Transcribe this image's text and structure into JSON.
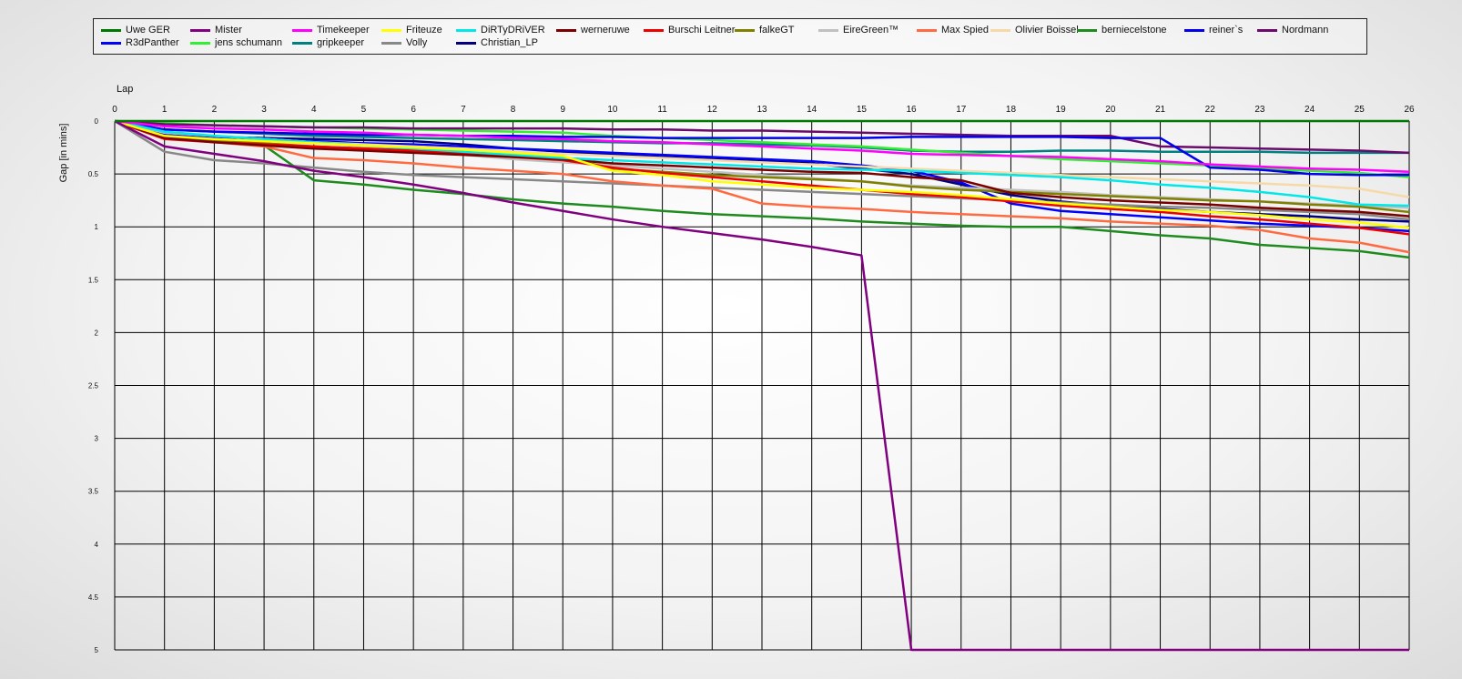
{
  "chart_data": {
    "type": "line",
    "xlabel": "Lap",
    "ylabel": "Gap [in mins]",
    "xlim": [
      0,
      26
    ],
    "ylim": [
      0,
      5
    ],
    "x_ticks": [
      0,
      1,
      2,
      3,
      4,
      5,
      6,
      7,
      8,
      9,
      10,
      11,
      12,
      13,
      14,
      15,
      16,
      17,
      18,
      19,
      20,
      21,
      22,
      23,
      24,
      25,
      26
    ],
    "y_ticks": [
      0,
      0.5,
      1,
      1.5,
      2,
      2.5,
      3,
      3.5,
      4,
      4.5,
      5
    ],
    "y_inverted": true,
    "grid": true,
    "legend_position": "top",
    "series": [
      {
        "name": "Uwe GER",
        "color": "#007700",
        "values": [
          0,
          0,
          0,
          0,
          0,
          0,
          0,
          0,
          0,
          0,
          0,
          0,
          0,
          0,
          0,
          0,
          0,
          0,
          0,
          0,
          0,
          0,
          0,
          0,
          0,
          0,
          0
        ]
      },
      {
        "name": "Mister",
        "color": "#800080",
        "values": [
          0,
          0.24,
          0.31,
          0.38,
          0.47,
          0.53,
          0.6,
          0.68,
          0.77,
          0.85,
          0.93,
          1.0,
          1.06,
          1.12,
          1.19,
          1.27,
          5.0,
          5.0,
          5.0,
          5.0,
          5.0,
          5.0,
          5.0,
          5.0,
          5.0,
          5.0,
          5.0
        ]
      },
      {
        "name": "Timekeeper",
        "color": "#ff00ff",
        "values": [
          0,
          0.05,
          0.07,
          0.08,
          0.1,
          0.11,
          0.13,
          0.14,
          0.16,
          0.17,
          0.19,
          0.2,
          0.22,
          0.24,
          0.26,
          0.28,
          0.31,
          0.32,
          0.33,
          0.34,
          0.36,
          0.38,
          0.41,
          0.43,
          0.45,
          0.46,
          0.48
        ]
      },
      {
        "name": "Friteuze",
        "color": "#ffff00",
        "values": [
          0,
          0.14,
          0.17,
          0.19,
          0.21,
          0.23,
          0.25,
          0.27,
          0.3,
          0.33,
          0.47,
          0.51,
          0.57,
          0.6,
          0.63,
          0.65,
          0.67,
          0.7,
          0.74,
          0.78,
          0.81,
          0.84,
          0.86,
          0.89,
          0.93,
          0.96,
          1.01
        ]
      },
      {
        "name": "DiRTyDRiVER",
        "color": "#00e8e8",
        "values": [
          0,
          0.1,
          0.14,
          0.17,
          0.2,
          0.23,
          0.26,
          0.29,
          0.32,
          0.35,
          0.37,
          0.39,
          0.41,
          0.43,
          0.45,
          0.46,
          0.47,
          0.49,
          0.51,
          0.53,
          0.56,
          0.6,
          0.63,
          0.67,
          0.72,
          0.79,
          0.8
        ]
      },
      {
        "name": "werneruwe",
        "color": "#7a0000",
        "values": [
          0,
          0.16,
          0.2,
          0.23,
          0.26,
          0.28,
          0.3,
          0.32,
          0.34,
          0.36,
          0.4,
          0.42,
          0.44,
          0.46,
          0.48,
          0.49,
          0.53,
          0.56,
          0.68,
          0.72,
          0.75,
          0.77,
          0.79,
          0.82,
          0.84,
          0.86,
          0.9
        ]
      },
      {
        "name": "Burschi Leitner",
        "color": "#ee0000",
        "values": [
          0,
          0.17,
          0.2,
          0.22,
          0.24,
          0.26,
          0.28,
          0.31,
          0.34,
          0.37,
          0.44,
          0.49,
          0.53,
          0.57,
          0.61,
          0.65,
          0.69,
          0.72,
          0.76,
          0.8,
          0.83,
          0.86,
          0.9,
          0.93,
          0.97,
          1.01,
          1.07
        ]
      },
      {
        "name": "falkeGT",
        "color": "#808000",
        "values": [
          0,
          0.15,
          0.18,
          0.21,
          0.24,
          0.26,
          0.28,
          0.3,
          0.32,
          0.34,
          0.45,
          0.48,
          0.51,
          0.53,
          0.55,
          0.57,
          0.62,
          0.65,
          0.67,
          0.69,
          0.71,
          0.73,
          0.75,
          0.76,
          0.79,
          0.81,
          0.86
        ]
      },
      {
        "name": "EireGreen™",
        "color": "#c0c0c0",
        "values": [
          0,
          0.11,
          0.14,
          0.17,
          0.2,
          0.24,
          0.27,
          0.32,
          0.36,
          0.39,
          0.42,
          0.45,
          0.48,
          0.51,
          0.54,
          0.57,
          0.61,
          0.63,
          0.65,
          0.67,
          0.7,
          0.72,
          0.74,
          0.76,
          0.78,
          0.8,
          0.82
        ]
      },
      {
        "name": "Max  Spied",
        "color": "#ff6a40",
        "values": [
          0,
          0.15,
          0.2,
          0.24,
          0.35,
          0.37,
          0.4,
          0.44,
          0.47,
          0.5,
          0.57,
          0.61,
          0.64,
          0.78,
          0.81,
          0.83,
          0.86,
          0.88,
          0.9,
          0.92,
          0.95,
          0.97,
          0.99,
          1.03,
          1.11,
          1.15,
          1.24
        ]
      },
      {
        "name": "Olivier Boissel",
        "color": "#f5d9a8",
        "values": [
          0,
          0.11,
          0.14,
          0.17,
          0.2,
          0.22,
          0.24,
          0.26,
          0.29,
          0.31,
          0.33,
          0.35,
          0.37,
          0.39,
          0.41,
          0.43,
          0.45,
          0.47,
          0.49,
          0.51,
          0.53,
          0.55,
          0.57,
          0.59,
          0.61,
          0.64,
          0.72
        ]
      },
      {
        "name": "berniecelstone",
        "color": "#1e8b1e",
        "values": [
          0,
          0.16,
          0.19,
          0.23,
          0.56,
          0.6,
          0.65,
          0.69,
          0.74,
          0.78,
          0.81,
          0.85,
          0.88,
          0.9,
          0.92,
          0.95,
          0.97,
          0.99,
          1.0,
          1.0,
          1.04,
          1.08,
          1.11,
          1.17,
          1.2,
          1.23,
          1.29
        ]
      },
      {
        "name": "reiner`s",
        "color": "#0000ee",
        "values": [
          0,
          0.08,
          0.1,
          0.11,
          0.12,
          0.13,
          0.13,
          0.14,
          0.14,
          0.15,
          0.15,
          0.16,
          0.16,
          0.16,
          0.16,
          0.16,
          0.15,
          0.15,
          0.15,
          0.15,
          0.16,
          0.16,
          0.44,
          0.46,
          0.5,
          0.51,
          0.51
        ]
      },
      {
        "name": "Nordmann",
        "color": "#6a0a6a",
        "values": [
          0,
          0.03,
          0.04,
          0.05,
          0.06,
          0.06,
          0.07,
          0.07,
          0.07,
          0.07,
          0.08,
          0.08,
          0.09,
          0.09,
          0.1,
          0.11,
          0.12,
          0.13,
          0.14,
          0.14,
          0.14,
          0.24,
          0.25,
          0.26,
          0.27,
          0.28,
          0.3
        ]
      },
      {
        "name": "R3dPanther",
        "color": "#0000ff",
        "values": [
          0,
          0.12,
          0.15,
          0.17,
          0.19,
          0.21,
          0.22,
          0.24,
          0.26,
          0.28,
          0.3,
          0.32,
          0.34,
          0.36,
          0.38,
          0.42,
          0.47,
          0.58,
          0.78,
          0.85,
          0.88,
          0.91,
          0.94,
          0.97,
          0.99,
          1.01,
          1.04
        ]
      },
      {
        "name": "jens  schumann",
        "color": "#33ee33",
        "values": [
          0,
          0.02,
          0.04,
          0.05,
          0.06,
          0.07,
          0.08,
          0.09,
          0.1,
          0.11,
          0.14,
          0.16,
          0.18,
          0.2,
          0.22,
          0.24,
          0.27,
          0.3,
          0.33,
          0.36,
          0.38,
          0.4,
          0.42,
          0.45,
          0.47,
          0.49,
          0.53
        ]
      },
      {
        "name": "gripkeeper",
        "color": "#008080",
        "values": [
          0,
          0.08,
          0.1,
          0.12,
          0.14,
          0.15,
          0.16,
          0.17,
          0.18,
          0.19,
          0.2,
          0.21,
          0.21,
          0.22,
          0.23,
          0.25,
          0.28,
          0.29,
          0.29,
          0.28,
          0.28,
          0.29,
          0.29,
          0.29,
          0.3,
          0.3,
          0.3
        ]
      },
      {
        "name": "Volly",
        "color": "#888888",
        "values": [
          0,
          0.29,
          0.37,
          0.4,
          0.44,
          0.48,
          0.51,
          0.53,
          0.55,
          0.57,
          0.59,
          0.61,
          0.63,
          0.65,
          0.67,
          0.69,
          0.71,
          0.73,
          0.75,
          0.77,
          0.79,
          0.81,
          0.82,
          0.84,
          0.86,
          0.88,
          0.93
        ]
      },
      {
        "name": "Christian_LP",
        "color": "#000080",
        "values": [
          0,
          0.13,
          0.15,
          0.16,
          0.17,
          0.18,
          0.19,
          0.22,
          0.26,
          0.29,
          0.32,
          0.34,
          0.36,
          0.38,
          0.4,
          0.45,
          0.5,
          0.6,
          0.7,
          0.76,
          0.8,
          0.83,
          0.86,
          0.88,
          0.9,
          0.93,
          0.95
        ]
      }
    ]
  }
}
